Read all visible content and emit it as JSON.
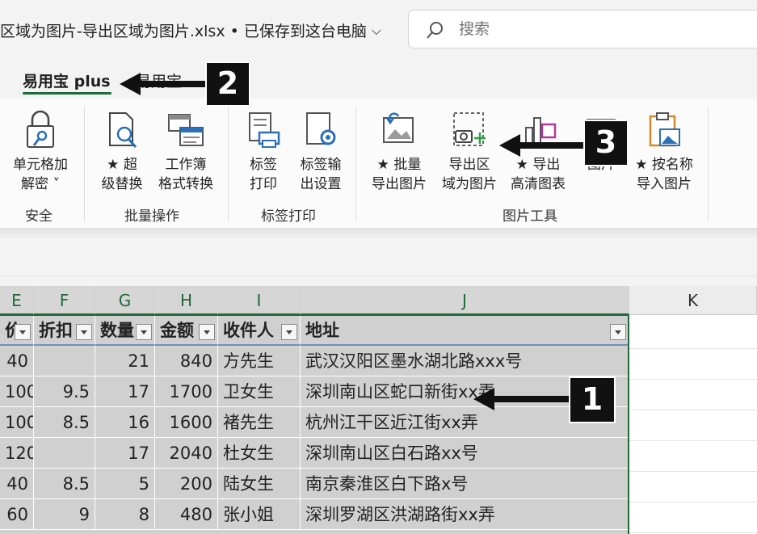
{
  "titlebar": {
    "doc_title": "区域为图片-导出区域为图片.xlsx • 已保存到这台电脑",
    "search_placeholder": "搜索"
  },
  "tabs": [
    {
      "label": "易用宝 plus",
      "active": true
    },
    {
      "label": "易用宝",
      "active": false
    }
  ],
  "ribbon": {
    "groups": [
      {
        "label": "安全",
        "buttons": [
          {
            "label_1": "单元格加",
            "label_2": "解密 ˅",
            "icon": "lock-key-icon"
          }
        ]
      },
      {
        "label": "批量操作",
        "buttons": [
          {
            "label_1": "★ 超",
            "label_2": "级替换",
            "icon": "document-search-icon"
          },
          {
            "label_1": "工作簿",
            "label_2": "格式转换",
            "icon": "workbook-convert-icon"
          }
        ]
      },
      {
        "label": "标签打印",
        "buttons": [
          {
            "label_1": "标签",
            "label_2": "打印",
            "icon": "label-print-icon"
          },
          {
            "label_1": "标签输",
            "label_2": "出设置",
            "icon": "label-settings-icon"
          }
        ]
      },
      {
        "label": "图片工具",
        "buttons": [
          {
            "label_1": "★ 批量",
            "label_2": "导出图片",
            "icon": "batch-export-picture-icon"
          },
          {
            "label_1": "导出区",
            "label_2": "域为图片",
            "icon": "export-range-picture-icon"
          },
          {
            "label_1": "★ 导出",
            "label_2": "高清图表",
            "icon": "export-chart-icon"
          },
          {
            "label_1": "",
            "label_2": "图片",
            "icon": "picture-icon"
          },
          {
            "label_1": "★ 按名称",
            "label_2": "导入图片",
            "icon": "import-picture-icon"
          }
        ]
      }
    ]
  },
  "grid": {
    "columns": [
      "E",
      "F",
      "G",
      "H",
      "I",
      "J",
      "K"
    ],
    "headers": [
      "价",
      "折扣",
      "数量",
      "金额",
      "收件人",
      "地址"
    ],
    "rows": [
      [
        "40",
        "",
        "21",
        "840",
        "方先生",
        "武汉汉阳区墨水湖北路xxx号"
      ],
      [
        "100",
        "9.5",
        "17",
        "1700",
        "卫女生",
        "深圳南山区蛇口新街xx弄"
      ],
      [
        "100",
        "8.5",
        "16",
        "1600",
        "褚先生",
        "杭州江干区近江街xx弄"
      ],
      [
        "120",
        "",
        "17",
        "2040",
        "杜女生",
        "深圳南山区白石路xx号"
      ],
      [
        "40",
        "8.5",
        "5",
        "200",
        "陆女生",
        "南京秦淮区白下路x号"
      ],
      [
        "60",
        "9",
        "8",
        "480",
        "张小姐",
        "深圳罗湖区洪湖路街xx弄"
      ]
    ]
  },
  "callouts": [
    {
      "number": "1"
    },
    {
      "number": "2"
    },
    {
      "number": "3"
    }
  ],
  "colors": {
    "accent": "#1e6b39",
    "selection": "#d0d0d0",
    "header_rule": "#6f93b8"
  }
}
